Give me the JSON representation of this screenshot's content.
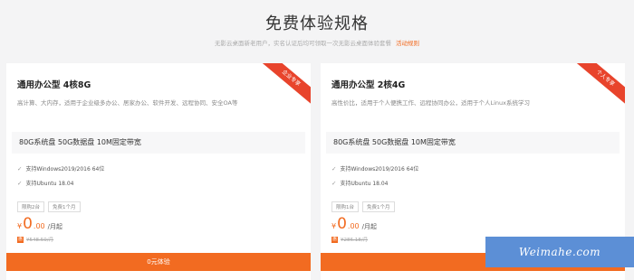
{
  "page": {
    "title": "免费体验规格",
    "subtitle": "无影云桌面新老用户，实名认证后均可领取一次无影云桌面体验套餐",
    "rule_link": "活动规则"
  },
  "colors": {
    "accent": "#f26b21",
    "ribbon": "#e8442c",
    "watermark_bg": "#5c8fd6"
  },
  "cards": [
    {
      "title": "通用办公型 4核8G",
      "ribbon": "企业专享",
      "desc": "高计算、大内存，适用于企业级多办公、居家办公、软件开发、远程协同、安全OA等",
      "spec": "80G系统盘 50G数据盘 10M固定带宽",
      "features": [
        "支持Windows2019/2016 64位",
        "支持Ubuntu 18.04"
      ],
      "tags": [
        "限购2台",
        "免费1个月"
      ],
      "price_currency": "¥",
      "price_amount": "0",
      "price_decimal": ".00",
      "price_unit": "/月起",
      "coupon_icon": "惠",
      "orig_price": "¥548.50/月",
      "button": "0元体验"
    },
    {
      "title": "通用办公型 2核4G",
      "ribbon": "个人专享",
      "desc": "高性价比，适用于个人便携工作、远程协同办公，适用于个人Linux系统学习",
      "spec": "80G系统盘 50G数据盘 10M固定带宽",
      "features": [
        "支持Windows2019/2016 64位",
        "支持Ubuntu 18.04"
      ],
      "tags": [
        "限购1台",
        "免费1个月"
      ],
      "price_currency": "¥",
      "price_amount": "0",
      "price_decimal": ".00",
      "price_unit": "/月起",
      "coupon_icon": "惠",
      "orig_price": "¥286.18/月"
    }
  ],
  "watermark": "Weimahe.com"
}
